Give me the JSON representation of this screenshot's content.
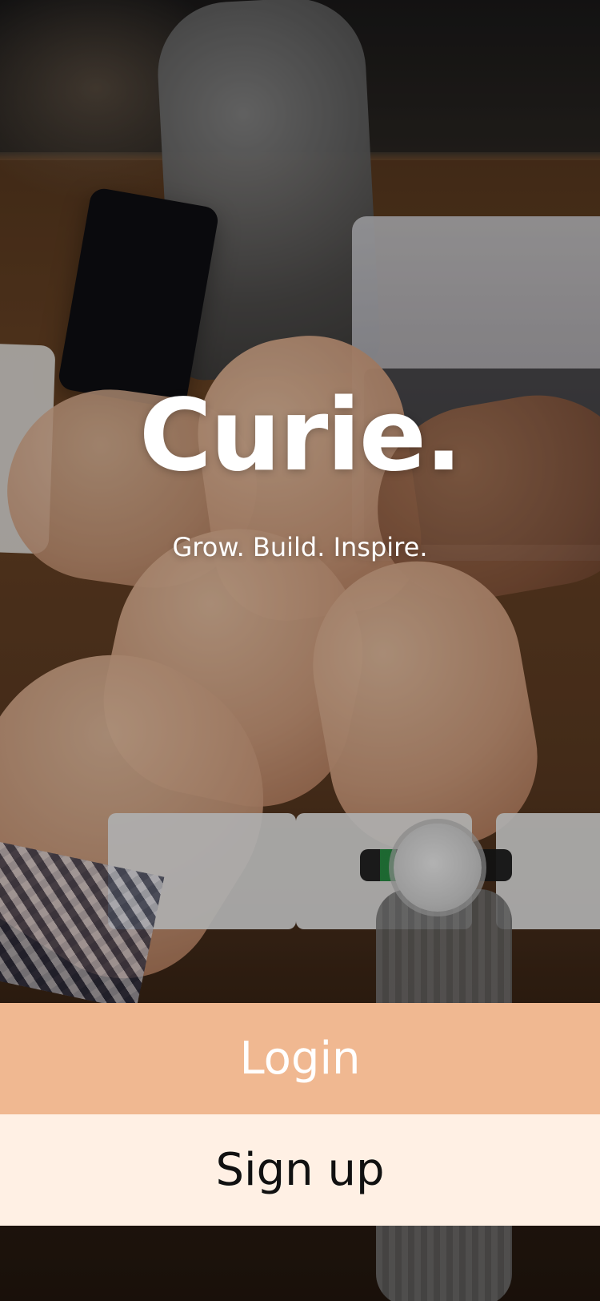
{
  "brand": {
    "name": "Curie.",
    "tagline": "Grow. Build. Inspire."
  },
  "actions": {
    "login_label": "Login",
    "signup_label": "Sign up"
  },
  "theme": {
    "login_bg": "#f0b891",
    "signup_bg": "#fff0e4",
    "text_light": "#ffffff",
    "text_dark": "#111111"
  }
}
